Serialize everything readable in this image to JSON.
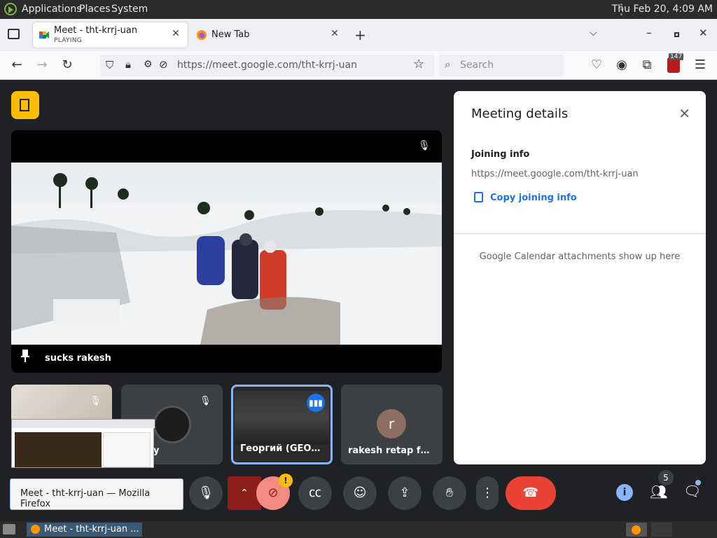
{
  "sysbar": {
    "menus": [
      "Applications",
      "Places",
      "System"
    ],
    "clock": "Thu Feb 20,  4:09 AM"
  },
  "tabs": [
    {
      "title": "Meet - tht-krrj-uan",
      "subtitle": "PLAYING"
    },
    {
      "title": "New Tab",
      "subtitle": ""
    }
  ],
  "nav": {
    "url": "https://meet.google.com/tht-krrj-uan",
    "search_placeholder": "Search",
    "extension_badge": "147"
  },
  "meet": {
    "main_participant": "sucks rakesh",
    "tiles": [
      {
        "name": ""
      },
      {
        "name": "y"
      },
      {
        "name": "Георгий (GEOE..."
      },
      {
        "name": "rakesh retap fo...",
        "avatar_letter": "r"
      }
    ],
    "panel": {
      "title": "Meeting details",
      "joining_heading": "Joining info",
      "joining_url": "https://meet.google.com/tht-krrj-uan",
      "copy_label": "Copy joining info",
      "calendar_note": "Google Calendar attachments show up here"
    },
    "tooltip": "Meet - tht-krrj-uan — Mozilla Firefox",
    "people_count": "5",
    "colors": {
      "accent": "#1a73e8",
      "hangup": "#ea4335",
      "host": "#fbbc04",
      "bg": "#202124"
    }
  },
  "taskbar": {
    "task_title": "Meet - tht-krrj-uan ..."
  }
}
